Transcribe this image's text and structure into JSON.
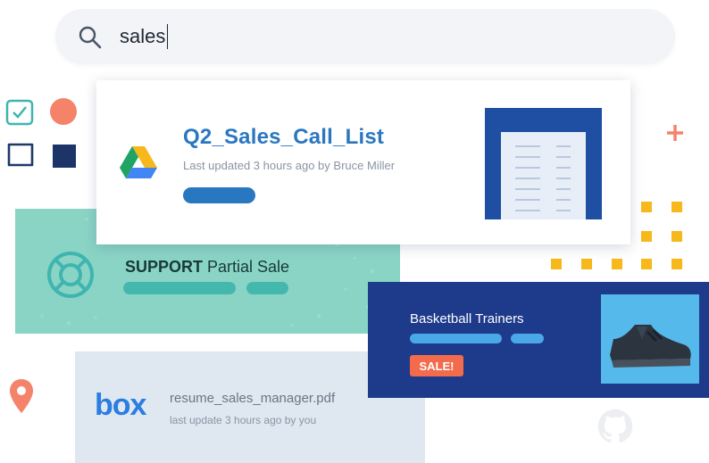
{
  "search": {
    "query": "sales",
    "icon": "search-icon"
  },
  "drive_card": {
    "title": "Q2_Sales_Call_List",
    "meta": "Last updated 3 hours ago by Bruce Miller",
    "logo": "google-drive-icon"
  },
  "support_card": {
    "label_bold": "SUPPORT",
    "label_rest": " Partial Sale",
    "icon": "lifebuoy-icon"
  },
  "basketball_card": {
    "title": "Basketball Trainers",
    "badge": "SALE!",
    "image": "sneaker-icon"
  },
  "box_card": {
    "logo_text": "box",
    "filename": "resume_sales_manager.pdf",
    "meta": "last update 3 hours ago by you"
  },
  "colors": {
    "accent_blue": "#2a77c1",
    "navy": "#1e3a8a",
    "teal": "#8ad4c6",
    "coral": "#f26b4c",
    "gold": "#f6b81a"
  }
}
